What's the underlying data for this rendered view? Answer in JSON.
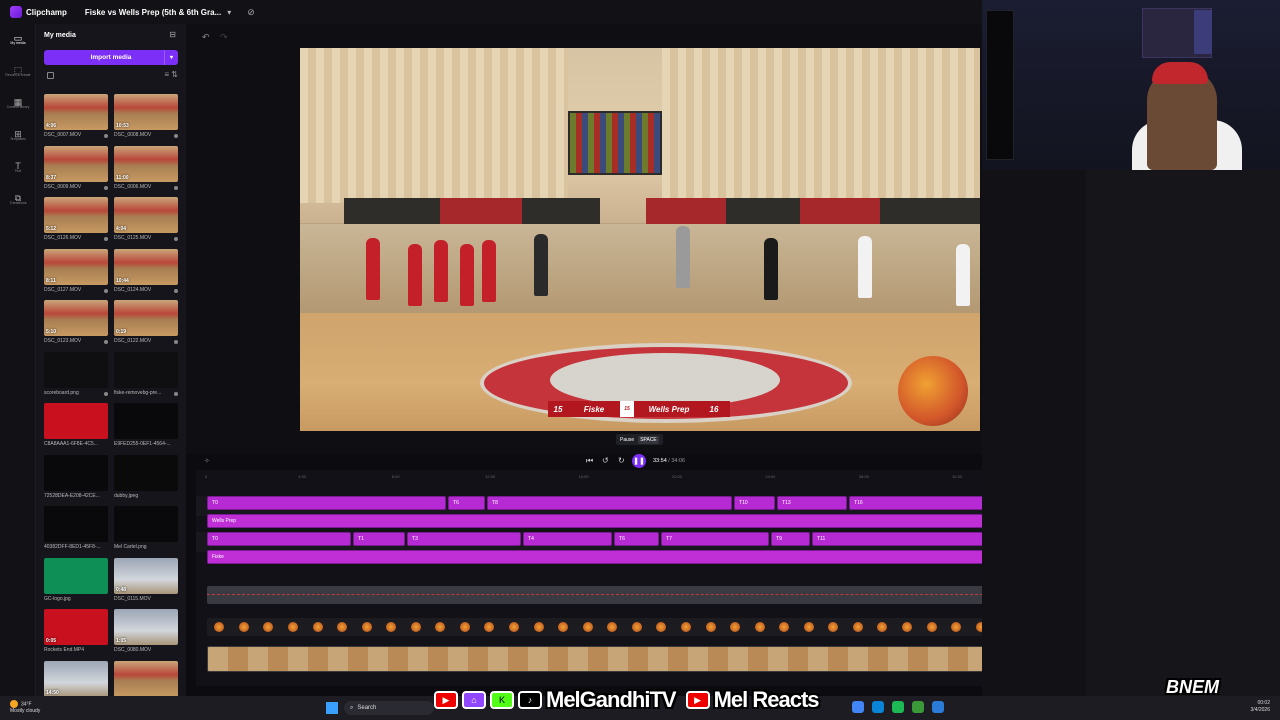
{
  "titlebar": {
    "app_name": "Clipchamp",
    "project_title": "Fiske vs Wells Prep (5th & 6th Gra...",
    "chevron": "▾"
  },
  "rail": [
    {
      "icon": "▭",
      "label": "My media"
    },
    {
      "icon": "⬚",
      "label": "Record & create"
    },
    {
      "icon": "▦",
      "label": "Content library"
    },
    {
      "icon": "⊞",
      "label": "Templates"
    },
    {
      "icon": "T",
      "label": "Text"
    },
    {
      "icon": "⧉",
      "label": "Transitions"
    }
  ],
  "media_panel": {
    "title": "My media",
    "import_label": "Import media",
    "items": [
      {
        "name": "DSC_0007.MOV",
        "duration": "4:06",
        "style": "court"
      },
      {
        "name": "DSC_0008.MOV",
        "duration": "10:53",
        "style": "court"
      },
      {
        "name": "DSC_0009.MOV",
        "duration": "8:37",
        "style": "court"
      },
      {
        "name": "DSC_0006.MOV",
        "duration": "11:00",
        "style": "court"
      },
      {
        "name": "DSC_0126.MOV",
        "duration": "5:12",
        "style": "court"
      },
      {
        "name": "DSC_0125.MOV",
        "duration": "4:04",
        "style": "court"
      },
      {
        "name": "DSC_0127.MOV",
        "duration": "8:11",
        "style": "court"
      },
      {
        "name": "DSC_0124.MOV",
        "duration": "10:44",
        "style": "court"
      },
      {
        "name": "DSC_0123.MOV",
        "duration": "5:10",
        "style": "court"
      },
      {
        "name": "DSC_0122.MOV",
        "duration": "0:19",
        "style": "court"
      },
      {
        "name": "scoreboard.png",
        "duration": "",
        "style": "dark"
      },
      {
        "name": "fiske-removebg-pre...",
        "duration": "",
        "style": "dark"
      },
      {
        "name": "C8A8AAA1-6F8E-4C5...",
        "duration": "",
        "style": "red"
      },
      {
        "name": "E9FED255-0EF1-4564-...",
        "duration": "",
        "style": "blk"
      },
      {
        "name": "72528DEA-E208-42CE...",
        "duration": "",
        "style": "blk"
      },
      {
        "name": "dubby.jpeg",
        "duration": "",
        "style": "yellow"
      },
      {
        "name": "40382DFF-8ED1-45F8-...",
        "duration": "",
        "style": "blk"
      },
      {
        "name": "Mel Cartel.png",
        "duration": "",
        "style": "blk"
      },
      {
        "name": "GC-logo.jpg",
        "duration": "",
        "style": "green"
      },
      {
        "name": "DSC_0115.MOV",
        "duration": "0:48",
        "style": "gym"
      },
      {
        "name": "Rockets End.MP4",
        "duration": "0:05",
        "style": "red"
      },
      {
        "name": "DSC_0080.MOV",
        "duration": "1:05",
        "style": "gym"
      },
      {
        "name": "",
        "duration": "14:50",
        "style": "gym"
      },
      {
        "name": "",
        "duration": "",
        "style": "court"
      }
    ]
  },
  "preview": {
    "home_score": "15",
    "home_team": "Fiske",
    "mid_label": "15",
    "away_team": "Wells Prep",
    "away_score": "16"
  },
  "tooltip": {
    "label": "Pause",
    "key": "SPACE"
  },
  "transport": {
    "current_time": "33:54",
    "total_time": "/ 34:06"
  },
  "ruler_ticks": [
    "0",
    "4:00",
    "8:00",
    "12:00",
    "16:00",
    "20:00",
    "24:00",
    "28:00",
    "32:00",
    "36:00"
  ],
  "tracks": {
    "row1": [
      "0",
      "6",
      "8",
      "10",
      "13",
      "16"
    ],
    "row2": [
      "Wells Prep"
    ],
    "row3": [
      "0",
      "1",
      "3",
      "4",
      "6",
      "7",
      "9",
      "11"
    ],
    "row4": [
      "Fiske"
    ]
  },
  "overlay": {
    "channel1": "MelGandhiTV",
    "channel2": "Mel Reacts",
    "brand": "BNEM"
  },
  "taskbar": {
    "temp": "34°F",
    "weather": "Mostly cloudy",
    "search": "Search",
    "time": "00:02",
    "date": "3/4/2026"
  },
  "colors": {
    "accent": "#7b2ff7",
    "clip": "#b62ad4",
    "score_red": "#b2171f"
  }
}
